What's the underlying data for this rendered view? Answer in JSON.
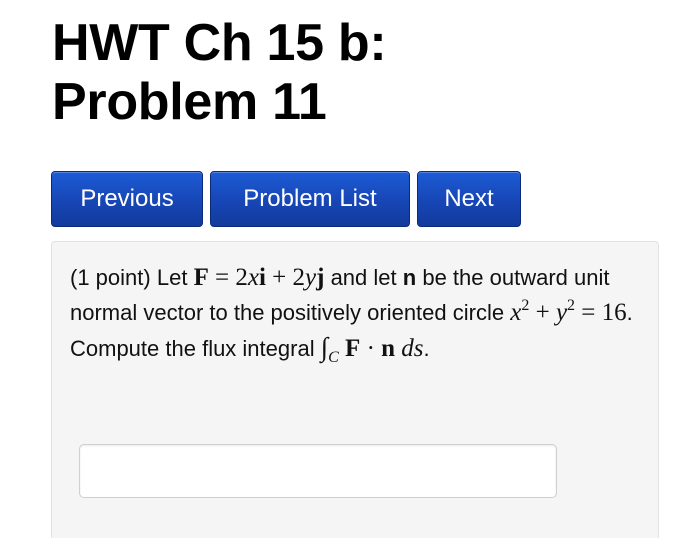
{
  "header": {
    "title_line1": "HWT Ch 15 b:",
    "title_line2": "Problem 11"
  },
  "nav": {
    "previous_label": "Previous",
    "problem_list_label": "Problem List",
    "next_label": "Next"
  },
  "problem": {
    "points": "(1 point)",
    "let_word": "Let",
    "field_symbol": "F",
    "field_definition": "= 2xi + 2yj",
    "and_let": "and let",
    "normal_symbol": "n",
    "be_the": "be the outward unit normal vector to the positively oriented circle",
    "circle_equation": "x² + y² = 16",
    "compute": ". Compute the flux integral",
    "integral_expression": "∫C F · n ds",
    "end": "."
  },
  "answer": {
    "value": "",
    "placeholder": ""
  }
}
